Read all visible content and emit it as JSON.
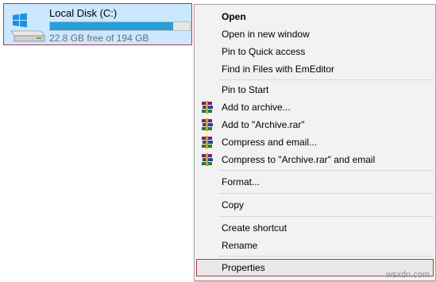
{
  "drive": {
    "label": "Local Disk (C:)",
    "free_text": "22.8 GB free of 194 GB",
    "used_fraction": 0.88,
    "bar_color": "#26a0da",
    "icon": "windows-drive-icon"
  },
  "menu": {
    "open": "Open",
    "open_new_window": "Open in new window",
    "pin_quick_access": "Pin to Quick access",
    "find_emeditor": "Find in Files with EmEditor",
    "pin_start": "Pin to Start",
    "add_archive": "Add to archive...",
    "add_archive_rar": "Add to \"Archive.rar\"",
    "compress_email": "Compress and email...",
    "compress_rar_email": "Compress to \"Archive.rar\" and email",
    "format": "Format...",
    "copy": "Copy",
    "create_shortcut": "Create shortcut",
    "rename": "Rename",
    "properties": "Properties",
    "archive_icon": "winrar-books-icon"
  },
  "watermark": "wsxdn.com"
}
